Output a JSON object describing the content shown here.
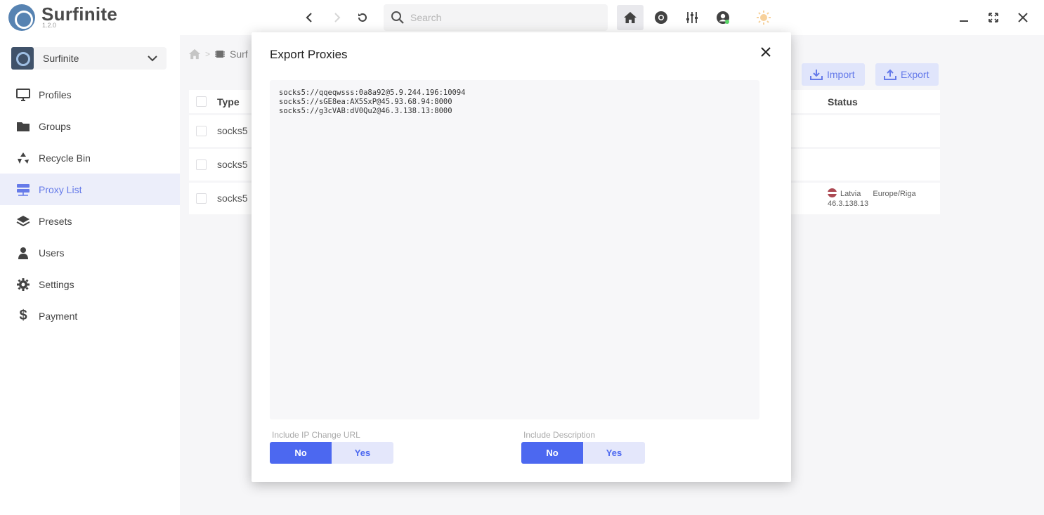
{
  "app": {
    "name": "Surfinite",
    "version": "1.2.0"
  },
  "toolbar": {
    "search_placeholder": "Search"
  },
  "sidebar": {
    "workspace": "Surfinite",
    "items": [
      {
        "label": "Profiles",
        "icon": "monitor-icon"
      },
      {
        "label": "Groups",
        "icon": "folder-icon"
      },
      {
        "label": "Recycle Bin",
        "icon": "recycle-icon"
      },
      {
        "label": "Proxy List",
        "icon": "server-icon",
        "active": true
      },
      {
        "label": "Presets",
        "icon": "layers-icon"
      },
      {
        "label": "Users",
        "icon": "user-icon"
      },
      {
        "label": "Settings",
        "icon": "gear-icon"
      },
      {
        "label": "Payment",
        "icon": "dollar-icon"
      }
    ]
  },
  "main": {
    "breadcrumb": "Surf",
    "import_label": "Import",
    "export_label": "Export",
    "table": {
      "headers": {
        "type": "Type",
        "status": "Status"
      },
      "rows": [
        {
          "type": "socks5"
        },
        {
          "type": "socks5"
        },
        {
          "type": "socks5",
          "country": "Latvia",
          "timezone": "Europe/Riga",
          "ip": "46.3.138.13"
        }
      ]
    }
  },
  "modal": {
    "title": "Export Proxies",
    "proxies_text": "socks5://qqeqwsss:0a8a92@5.9.244.196:10094\nsocks5://sGE8ea:AX5SxP@45.93.68.94:8000\nsocks5://g3cVAB:dV0Qu2@46.3.138.13:8000",
    "ip_change": {
      "label": "Include IP Change URL",
      "no": "No",
      "yes": "Yes",
      "selected": "No"
    },
    "description": {
      "label": "Include Description",
      "no": "No",
      "yes": "Yes",
      "selected": "No"
    }
  },
  "colors": {
    "accent": "#4c68f0",
    "accent_light": "#e4e7fb",
    "sidebar_active_bg": "#e9ecfa"
  }
}
